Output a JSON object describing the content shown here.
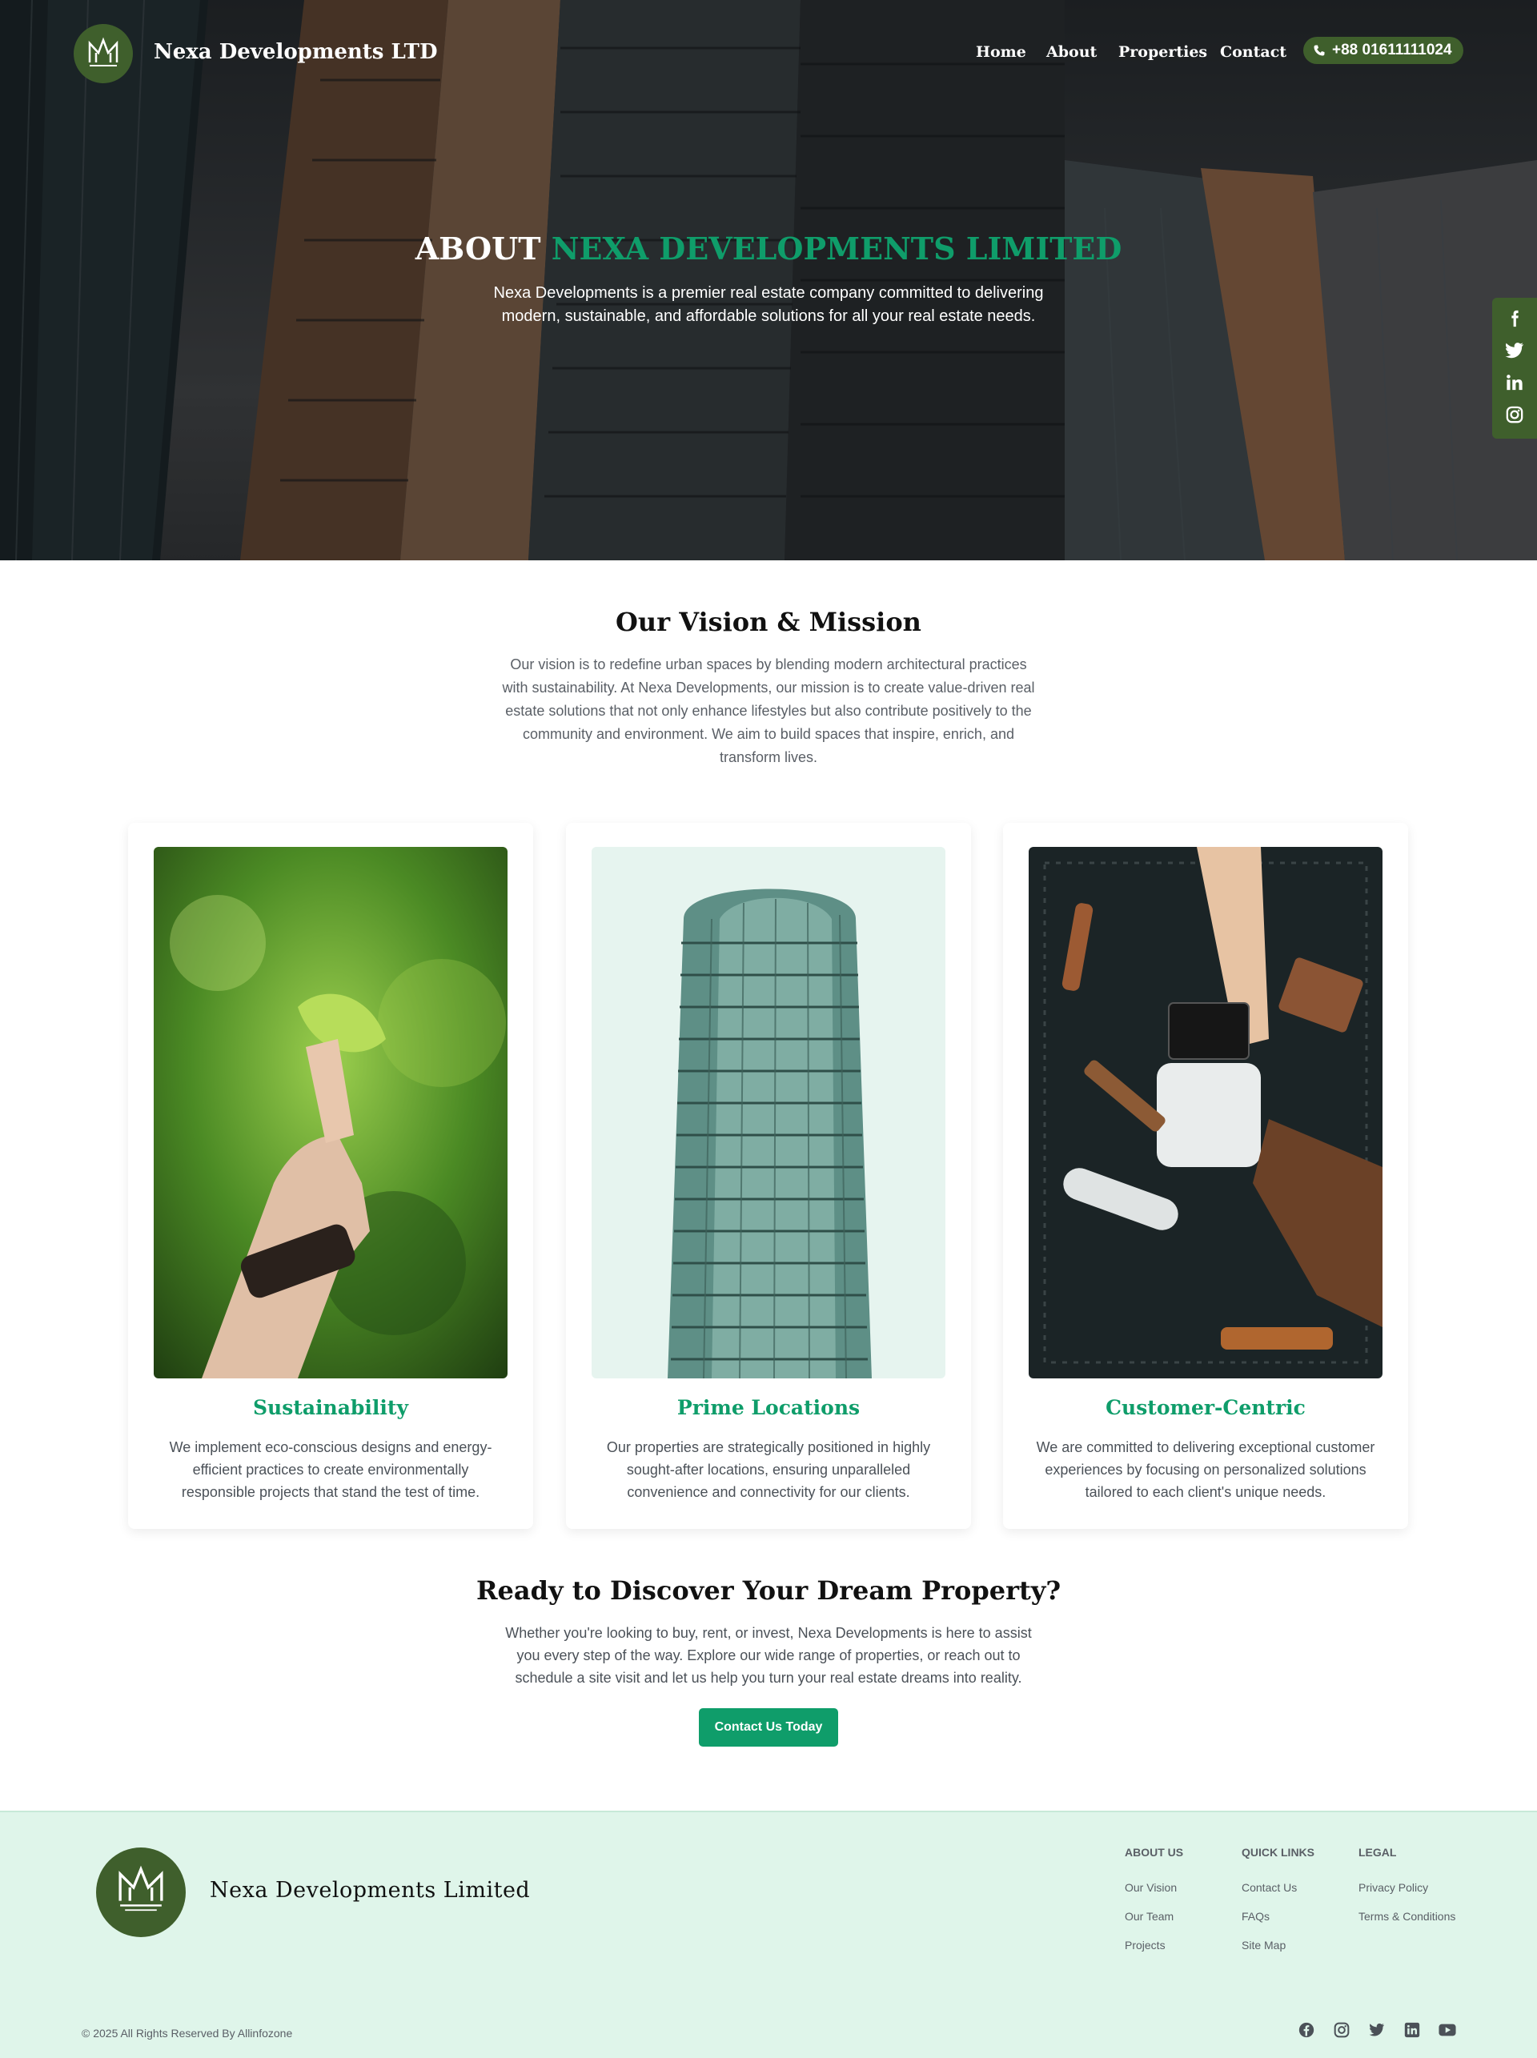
{
  "header": {
    "brand": "Nexa Developments LTD",
    "nav": [
      "Home",
      "About",
      "Properties",
      "Contact"
    ],
    "phone": "+88 01611111024"
  },
  "hero": {
    "title_plain": "ABOUT",
    "title_accent": "NEXA DEVELOPMENTS LIMITED",
    "subtitle": "Nexa Developments is a premier real estate company committed to delivering modern, sustainable, and affordable solutions for all your real estate needs."
  },
  "social_sidebar": [
    "facebook-icon",
    "twitter-icon",
    "linkedin-icon",
    "instagram-icon"
  ],
  "vision": {
    "title": "Our Vision & Mission",
    "text": "Our vision is to redefine urban spaces by blending modern architectural practices with sustainability. At Nexa Developments, our mission is to create value-driven real estate solutions that not only enhance lifestyles but also contribute positively to the community and environment. We aim to build spaces that inspire, enrich, and transform lives."
  },
  "cards": [
    {
      "title": "Sustainability",
      "text": "We implement eco-conscious designs and energy-efficient practices to create environmentally responsible projects that stand the test of time."
    },
    {
      "title": "Prime Locations",
      "text": "Our properties are strategically positioned in highly sought-after locations, ensuring unparalleled convenience and connectivity for our clients."
    },
    {
      "title": "Customer-Centric",
      "text": "We are committed to delivering exceptional customer experiences by focusing on personalized solutions tailored to each client's unique needs."
    }
  ],
  "cta": {
    "title": "Ready to Discover Your Dream Property?",
    "text": "Whether you're looking to buy, rent, or invest, Nexa Developments is here to assist you every step of the way. Explore our wide range of properties, or reach out to schedule a site visit and let us help you turn your real estate dreams into reality.",
    "button": "Contact Us Today"
  },
  "footer": {
    "brand": "Nexa Developments Limited",
    "columns": [
      {
        "heading": "ABOUT US",
        "links": [
          "Our Vision",
          "Our Team",
          "Projects"
        ]
      },
      {
        "heading": "QUICK LINKS",
        "links": [
          "Contact Us",
          "FAQs",
          "Site Map"
        ]
      },
      {
        "heading": "LEGAL",
        "links": [
          "Privacy Policy",
          "Terms & Conditions"
        ]
      }
    ],
    "copyright": "© 2025 All Rights Reserved By Allinfozone",
    "social": [
      "facebook-icon",
      "instagram-icon",
      "twitter-icon",
      "linkedin-icon",
      "youtube-icon"
    ]
  },
  "colors": {
    "accent": "#0f9d6a",
    "logo_green": "#3f5f2c",
    "footer_bg": "#dff5ea"
  }
}
